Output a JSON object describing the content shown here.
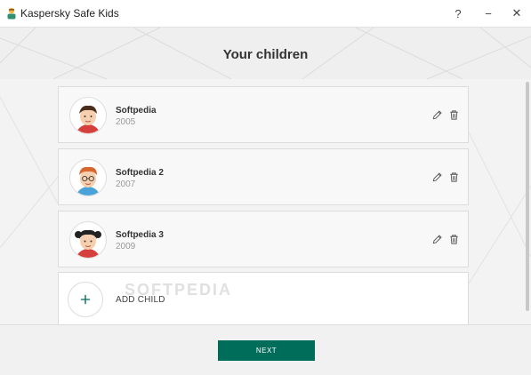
{
  "window": {
    "title": "Kaspersky Safe Kids",
    "help": "?",
    "minimize": "−",
    "close": "✕"
  },
  "header": {
    "title": "Your children"
  },
  "children": [
    {
      "name": "Softpedia",
      "year": "2005",
      "avatar": "boy-avatar"
    },
    {
      "name": "Softpedia 2",
      "year": "2007",
      "avatar": "boy-glasses-avatar"
    },
    {
      "name": "Softpedia 3",
      "year": "2009",
      "avatar": "girl-avatar"
    }
  ],
  "add_child": {
    "label": "ADD CHILD",
    "icon": "plus-icon",
    "watermark": "SOFTPEDIA"
  },
  "footer": {
    "next_label": "NEXT"
  },
  "colors": {
    "accent": "#006d5b",
    "header_bg": "#efefef",
    "page_bg": "#f3f3f3"
  }
}
